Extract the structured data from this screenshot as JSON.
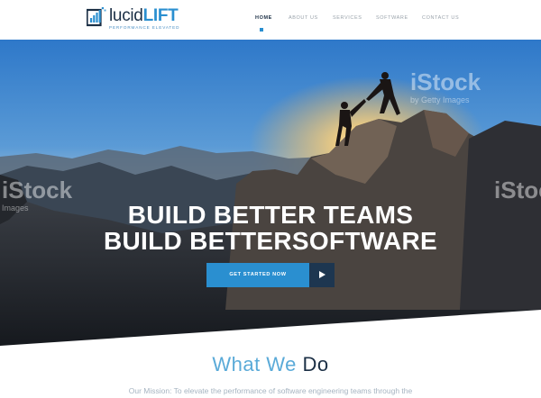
{
  "brand": {
    "name_part1": "lucid",
    "name_part2": "LIFT",
    "tagline": "PERFORMANCE ELEVATED",
    "colors": {
      "navy": "#1b2f45",
      "blue": "#2a8fd0",
      "light_blue": "#5aaad8"
    }
  },
  "nav": {
    "items": [
      {
        "label": "HOME",
        "active": true
      },
      {
        "label": "ABOUT US",
        "active": false
      },
      {
        "label": "SERVICES",
        "active": false
      },
      {
        "label": "SOFTWARE",
        "active": false
      },
      {
        "label": "CONTACT US",
        "active": false
      }
    ]
  },
  "hero": {
    "headline_line1": "BUILD BETTER TEAMS",
    "headline_line2": "BUILD BETTERSOFTWARE",
    "cta_label": "GET STARTED NOW",
    "cta_icon": "play-icon",
    "watermark_text": "iStock",
    "watermark_sub": "by Getty Images",
    "watermark_sub_short": "Images"
  },
  "section": {
    "title_part1": "What We",
    "title_part2": "Do",
    "mission": "Our Mission: To elevate the performance of software engineering teams through the"
  }
}
